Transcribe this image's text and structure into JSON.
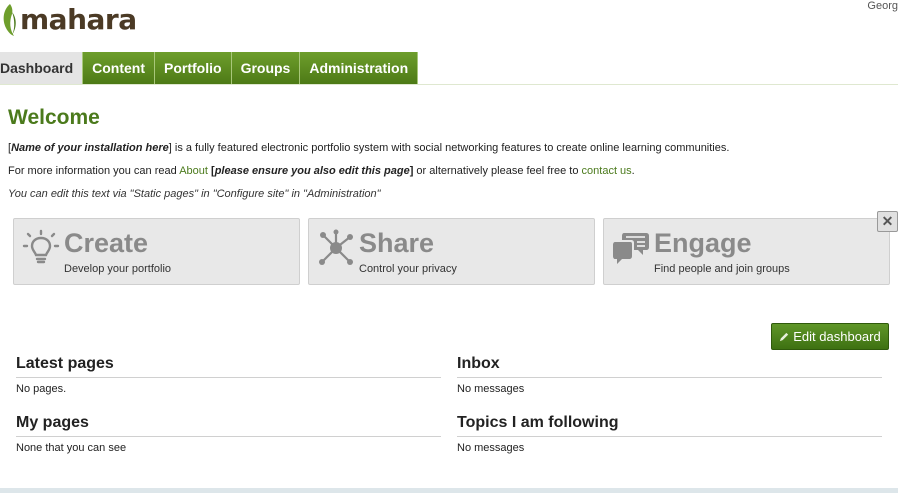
{
  "header": {
    "logo_text": "mahara",
    "user_name": "Georg"
  },
  "nav": {
    "tabs": [
      {
        "label": "Dashboard",
        "active": true
      },
      {
        "label": "Content",
        "active": false
      },
      {
        "label": "Portfolio",
        "active": false
      },
      {
        "label": "Groups",
        "active": false
      },
      {
        "label": "Administration",
        "active": false
      }
    ]
  },
  "welcome": {
    "title": "Welcome",
    "p1_bold": "Name of your installation here",
    "p1_rest": " is a fully featured electronic portfolio system with social networking features to create online learning communities.",
    "p2_a": "For more information you can read ",
    "p2_link_about": "About",
    "p2_b_bold": "please ensure you also edit this page",
    "p2_c": " or alternatively please feel free to ",
    "p2_link_contact": "contact us",
    "p2_d": ".",
    "p3": "You can edit this text via \"Static pages\" in \"Configure site\" in \"Administration\""
  },
  "boxes": [
    {
      "title": "Create",
      "subtitle": "Develop your portfolio",
      "icon": "lightbulb-icon"
    },
    {
      "title": "Share",
      "subtitle": "Control your privacy",
      "icon": "share-network-icon"
    },
    {
      "title": "Engage",
      "subtitle": "Find people and join groups",
      "icon": "speech-bubbles-icon"
    }
  ],
  "close_label": "✕",
  "edit_dashboard_label": "Edit dashboard",
  "blocks": {
    "latest_pages": {
      "title": "Latest pages",
      "body": "No pages."
    },
    "my_pages": {
      "title": "My pages",
      "body": "None that you can see"
    },
    "inbox": {
      "title": "Inbox",
      "body": "No messages"
    },
    "topics": {
      "title": "Topics I am following",
      "body": "No messages"
    }
  },
  "colors": {
    "brand_green": "#4b7a1c",
    "nav_green": "#5c8a22",
    "box_bg": "#e8e8e8"
  }
}
